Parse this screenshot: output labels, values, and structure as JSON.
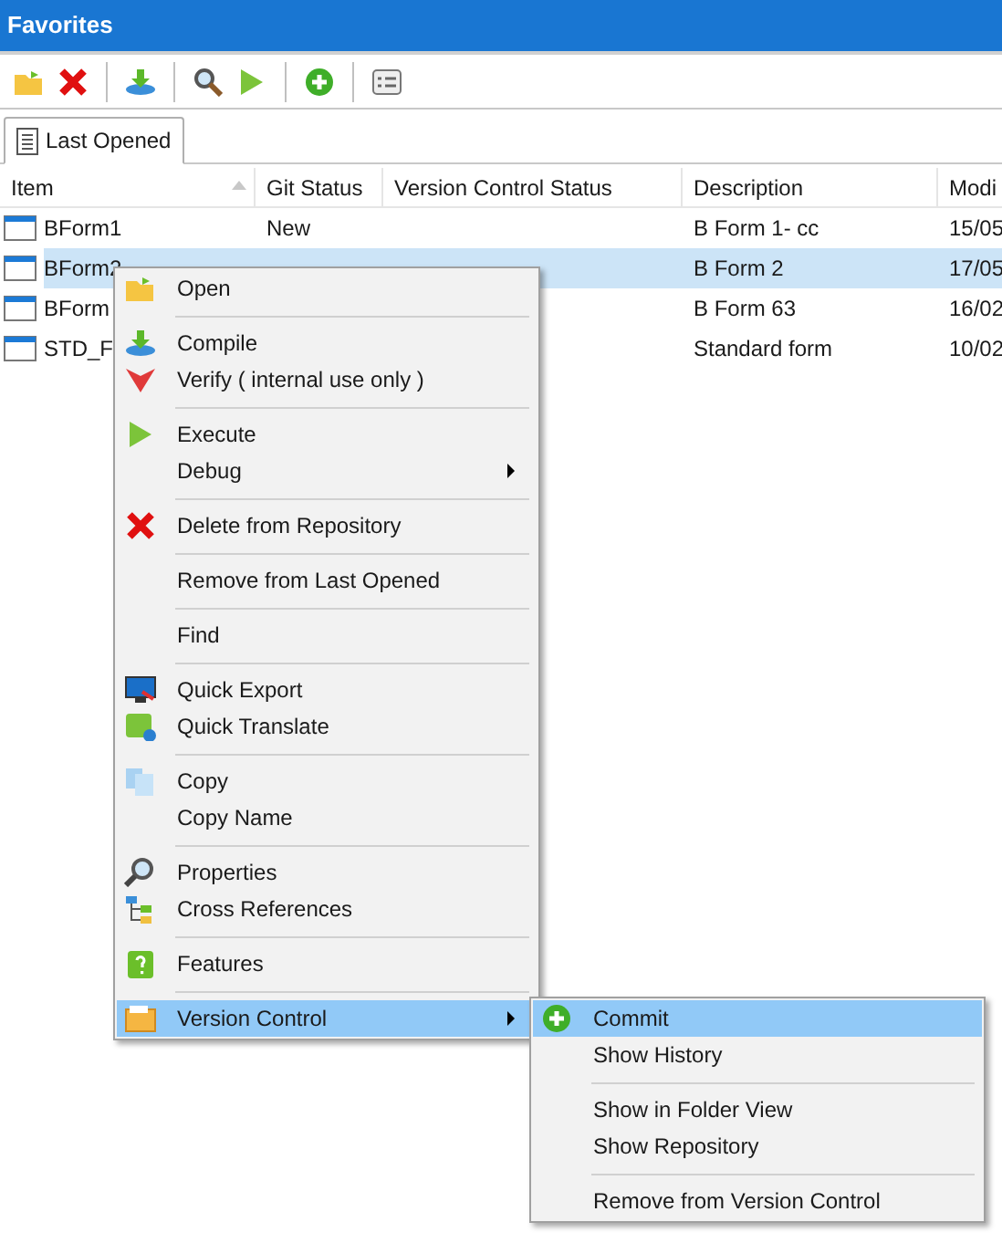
{
  "window": {
    "title": "Favorites"
  },
  "tabs": [
    {
      "label": "Last Opened",
      "selected": true
    }
  ],
  "table": {
    "columns": [
      "Item",
      "Git Status",
      "Version Control Status",
      "Description",
      "Modi"
    ],
    "rows": [
      {
        "cells": [
          "BForm1",
          "New",
          "",
          "B Form 1- cc",
          "15/05"
        ],
        "selected": false
      },
      {
        "cells": [
          "BForm2",
          "",
          "",
          "B Form 2",
          "17/05"
        ],
        "selected": true
      },
      {
        "cells": [
          "BForm",
          "",
          "",
          "B Form 63",
          "16/02"
        ],
        "selected": false
      },
      {
        "cells": [
          "STD_F",
          "",
          "",
          "Standard form",
          "10/02"
        ],
        "selected": false
      }
    ]
  },
  "context_menu": {
    "items": [
      {
        "kind": "item",
        "label": "Open",
        "has_submenu": false,
        "selected": false
      },
      {
        "kind": "separator"
      },
      {
        "kind": "item",
        "label": "Compile",
        "has_submenu": false,
        "selected": false
      },
      {
        "kind": "item",
        "label": "Verify ( internal use only )",
        "has_submenu": false,
        "selected": false
      },
      {
        "kind": "separator"
      },
      {
        "kind": "item",
        "label": "Execute",
        "has_submenu": false,
        "selected": false
      },
      {
        "kind": "item",
        "label": "Debug",
        "has_submenu": true,
        "selected": false
      },
      {
        "kind": "separator"
      },
      {
        "kind": "item",
        "label": "Delete from Repository",
        "has_submenu": false,
        "selected": false
      },
      {
        "kind": "separator"
      },
      {
        "kind": "item",
        "label": "Remove from Last Opened",
        "has_submenu": false,
        "selected": false
      },
      {
        "kind": "separator"
      },
      {
        "kind": "item",
        "label": "Find",
        "has_submenu": false,
        "selected": false
      },
      {
        "kind": "separator"
      },
      {
        "kind": "item",
        "label": "Quick Export",
        "has_submenu": false,
        "selected": false
      },
      {
        "kind": "item",
        "label": "Quick Translate",
        "has_submenu": false,
        "selected": false
      },
      {
        "kind": "separator"
      },
      {
        "kind": "item",
        "label": "Copy",
        "has_submenu": false,
        "selected": false
      },
      {
        "kind": "item",
        "label": "Copy Name",
        "has_submenu": false,
        "selected": false
      },
      {
        "kind": "separator"
      },
      {
        "kind": "item",
        "label": "Properties",
        "has_submenu": false,
        "selected": false
      },
      {
        "kind": "item",
        "label": "Cross References",
        "has_submenu": false,
        "selected": false
      },
      {
        "kind": "separator"
      },
      {
        "kind": "item",
        "label": "Features",
        "has_submenu": false,
        "selected": false
      },
      {
        "kind": "separator"
      },
      {
        "kind": "item",
        "label": "Version Control",
        "has_submenu": true,
        "selected": true
      }
    ]
  },
  "submenu": {
    "items": [
      {
        "kind": "item",
        "label": "Commit",
        "selected": true
      },
      {
        "kind": "item",
        "label": "Show History",
        "selected": false
      },
      {
        "kind": "separator"
      },
      {
        "kind": "item",
        "label": "Show in Folder View",
        "selected": false
      },
      {
        "kind": "item",
        "label": "Show Repository",
        "selected": false
      },
      {
        "kind": "separator"
      },
      {
        "kind": "item",
        "label": "Remove from Version Control",
        "selected": false
      }
    ]
  }
}
